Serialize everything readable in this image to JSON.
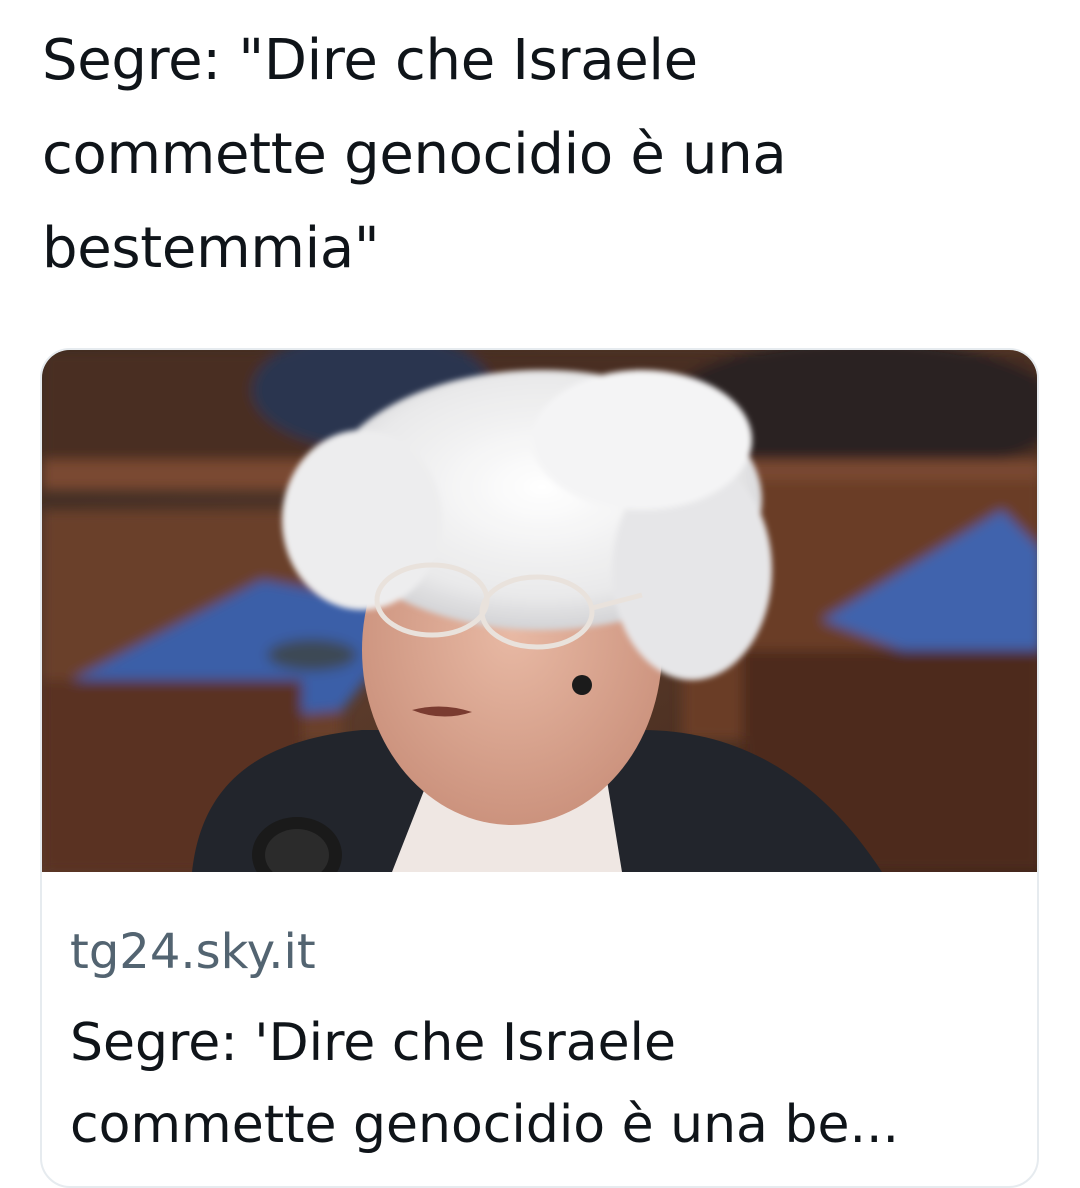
{
  "tweet": {
    "text_lines": [
      "Segre: \"Dire che Israele",
      "commette genocidio è una",
      "bestemmia\""
    ]
  },
  "link_card": {
    "image_icon": "news-photo-elderly-woman-speaking-into-microphone-icon",
    "domain": "tg24.sky.it",
    "title_lines": [
      "Segre: 'Dire che Israele",
      "commette genocidio è una be..."
    ]
  },
  "colors": {
    "text": "#0f1419",
    "secondary_text": "#536471",
    "card_border": "#e6ebef",
    "background": "#ffffff"
  }
}
